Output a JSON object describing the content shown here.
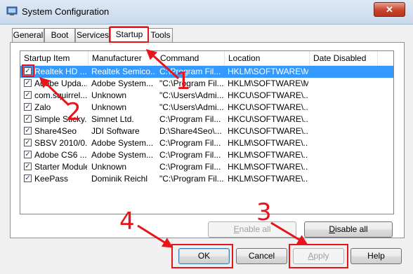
{
  "window": {
    "title": "System Configuration",
    "close_label": "✕"
  },
  "tabs": [
    {
      "label": "General"
    },
    {
      "label": "Boot"
    },
    {
      "label": "Services"
    },
    {
      "label": "Startup"
    },
    {
      "label": "Tools"
    }
  ],
  "active_tab": "Startup",
  "table": {
    "columns": [
      "Startup Item",
      "Manufacturer",
      "Command",
      "Location",
      "Date Disabled"
    ],
    "rows": [
      {
        "checked": true,
        "item": "Realtek HD ...",
        "manufacturer": "Realtek Semico...",
        "command": "C:\\Program Fil...",
        "location": "HKLM\\SOFTWARE\\M...",
        "date": ""
      },
      {
        "checked": true,
        "item": "Adobe Upda...",
        "manufacturer": "Adobe System...",
        "command": "\"C:\\Program Fil...",
        "location": "HKLM\\SOFTWARE\\M...",
        "date": ""
      },
      {
        "checked": true,
        "item": "com.squirrel....",
        "manufacturer": "Unknown",
        "command": "\"C:\\Users\\Admi...",
        "location": "HKCU\\SOFTWARE\\...",
        "date": ""
      },
      {
        "checked": true,
        "item": "Zalo",
        "manufacturer": "Unknown",
        "command": "\"C:\\Users\\Admi...",
        "location": "HKCU\\SOFTWARE\\...",
        "date": ""
      },
      {
        "checked": true,
        "item": "Simple Sticky...",
        "manufacturer": "Simnet Ltd.",
        "command": "C:\\Program Fil...",
        "location": "HKCU\\SOFTWARE\\...",
        "date": ""
      },
      {
        "checked": true,
        "item": "Share4Seo",
        "manufacturer": "JDI Software",
        "command": "D:\\Share4Seo\\...",
        "location": "HKCU\\SOFTWARE\\...",
        "date": ""
      },
      {
        "checked": true,
        "item": "SBSV 2010/0...",
        "manufacturer": "Adobe System...",
        "command": "C:\\Program Fil...",
        "location": "HKLM\\SOFTWARE\\...",
        "date": ""
      },
      {
        "checked": true,
        "item": "Adobe CS6 ...",
        "manufacturer": "Adobe System...",
        "command": "C:\\Program Fil...",
        "location": "HKLM\\SOFTWARE\\...",
        "date": ""
      },
      {
        "checked": true,
        "item": "Starter Module",
        "manufacturer": "Unknown",
        "command": "C:\\Program Fil...",
        "location": "HKLM\\SOFTWARE\\...",
        "date": ""
      },
      {
        "checked": true,
        "item": "KeePass",
        "manufacturer": "Dominik Reichl",
        "command": "\"C:\\Program Fil...",
        "location": "HKLM\\SOFTWARE\\...",
        "date": ""
      }
    ]
  },
  "buttons": {
    "enable_all": {
      "prefix": "",
      "key": "E",
      "rest": "nable all"
    },
    "disable_all": {
      "prefix": "",
      "key": "D",
      "rest": "isable all"
    },
    "ok": "OK",
    "cancel": "Cancel",
    "apply": {
      "prefix": "",
      "key": "A",
      "rest": "pply"
    },
    "help": "Help"
  },
  "annotations": {
    "step1": "1",
    "step2": "2",
    "step3": "3",
    "step4": "4",
    "color": "#e8141b"
  },
  "colors": {
    "selection": "#3399ff",
    "title_bar": "#c9d9ec",
    "close_button": "#c8442a"
  }
}
